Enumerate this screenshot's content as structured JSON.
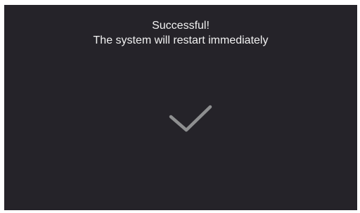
{
  "dialog": {
    "title": "Successful!",
    "message": "The system will restart immediately",
    "icon": "checkmark-icon",
    "colors": {
      "background": "#252329",
      "text": "#f2f2f2",
      "icon": "#8e8f90"
    }
  }
}
